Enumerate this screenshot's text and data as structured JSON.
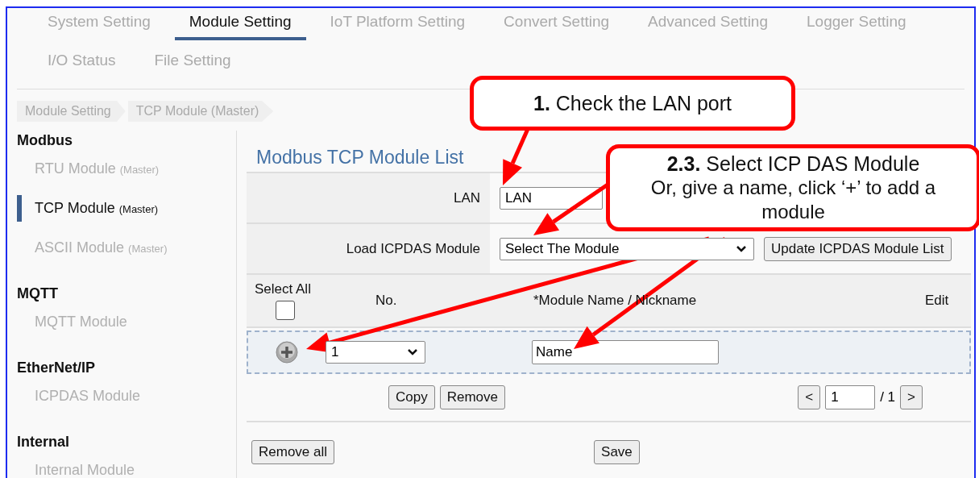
{
  "tabs": [
    {
      "label": "System Setting",
      "selected": false
    },
    {
      "label": "Module Setting",
      "selected": true
    },
    {
      "label": "IoT Platform Setting",
      "selected": false
    },
    {
      "label": "Convert Setting",
      "selected": false
    },
    {
      "label": "Advanced Setting",
      "selected": false
    },
    {
      "label": "Logger Setting",
      "selected": false
    },
    {
      "label": "I/O Status",
      "selected": false
    },
    {
      "label": "File Setting",
      "selected": false
    }
  ],
  "breadcrumb": [
    "Module Setting",
    "TCP Module (Master)"
  ],
  "sidebar": {
    "groups": [
      {
        "title": "Modbus",
        "items": [
          {
            "label": "RTU Module",
            "note": "(Master)",
            "selected": false
          },
          {
            "label": "TCP Module",
            "note": "(Master)",
            "selected": true
          },
          {
            "label": "ASCII Module",
            "note": "(Master)",
            "selected": false
          }
        ]
      },
      {
        "title": "MQTT",
        "items": [
          {
            "label": "MQTT Module",
            "selected": false
          }
        ]
      },
      {
        "title": "EtherNet/IP",
        "items": [
          {
            "label": "ICPDAS Module",
            "selected": false
          }
        ]
      },
      {
        "title": "Internal",
        "items": [
          {
            "label": "Internal Module",
            "selected": false
          }
        ]
      }
    ]
  },
  "content": {
    "title": "Modbus TCP Module List",
    "form": [
      {
        "label": "LAN",
        "kind": "text",
        "value": "LAN"
      },
      {
        "label": "Load ICPDAS Module",
        "kind": "select",
        "value": "Select The Module",
        "button": "Update ICPDAS Module List"
      }
    ],
    "list": {
      "select_all": {
        "label": "Select All",
        "checked": false
      },
      "columns": [
        "No.",
        "*Module Name / Nickname",
        "Edit"
      ],
      "new_row": {
        "number": "1",
        "name": "Name"
      },
      "buttons": [
        "Copy",
        "Remove"
      ],
      "pager": {
        "prev": "<",
        "page": "1",
        "total": "/ 1",
        "next": ">"
      }
    },
    "footer_buttons": [
      "Remove all",
      "Save"
    ]
  },
  "callouts": [
    {
      "text": "**1.** Check the LAN port"
    },
    {
      "title": "**2.3.** Select ICP DAS Module",
      "text": "Or, give a name, click ‘+’ to add a module"
    }
  ]
}
